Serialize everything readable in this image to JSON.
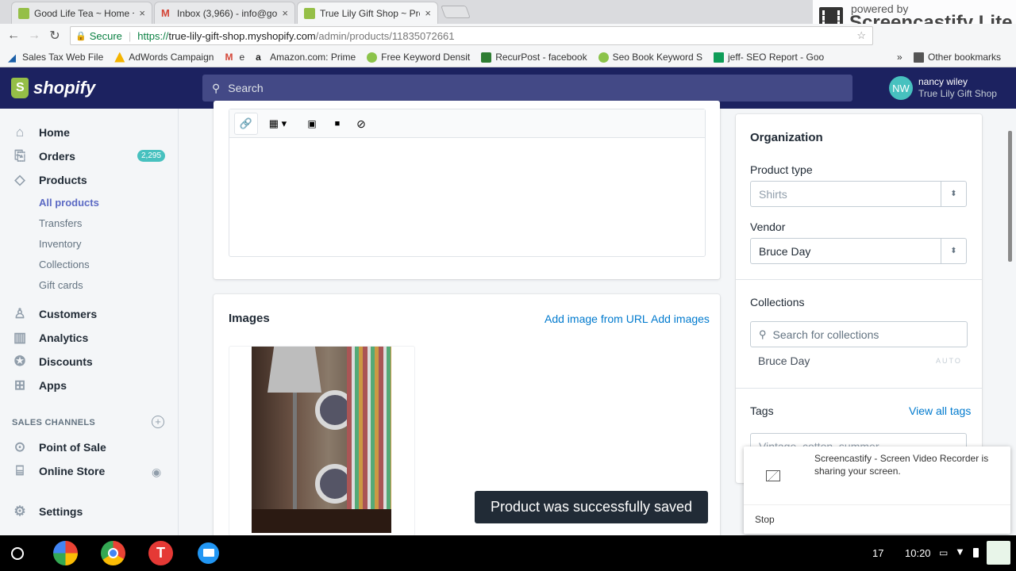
{
  "tabs": [
    {
      "title": "Good Life Tea ~ Home ~",
      "close": "×"
    },
    {
      "title": "Inbox (3,966) - info@goo",
      "close": "×"
    },
    {
      "title": "True Lily Gift Shop ~ Pro",
      "close": "×"
    }
  ],
  "address": {
    "secure_label": "Secure",
    "url_scheme": "https://",
    "url_host": "true-lily-gift-shop.myshopify.com",
    "url_path": "/admin/products/11835072661"
  },
  "bookmarks": [
    {
      "label": "Sales Tax Web File"
    },
    {
      "label": "AdWords Campaign"
    },
    {
      "label": "e"
    },
    {
      "label": "Amazon.com: Prime"
    },
    {
      "label": "Free Keyword Densit"
    },
    {
      "label": "RecurPost - facebook"
    },
    {
      "label": "Seo Book Keyword S"
    },
    {
      "label": "jeff- SEO Report - Goo"
    }
  ],
  "bookmarks_more": "»",
  "other_bookmarks": "Other bookmarks",
  "screencastify_badge": {
    "line1": "powered by",
    "line2": "Screencastify Lite"
  },
  "shopify": {
    "logo_text": "shopify",
    "search_placeholder": "Search",
    "user": {
      "initials": "NW",
      "name": "nancy wiley",
      "store": "True Lily Gift Shop"
    }
  },
  "sidebar": {
    "items": [
      {
        "label": "Home",
        "icon": "home-icon"
      },
      {
        "label": "Orders",
        "icon": "orders-icon",
        "badge": "2,295"
      },
      {
        "label": "Products",
        "icon": "tag-icon"
      }
    ],
    "sub_items": [
      "All products",
      "Transfers",
      "Inventory",
      "Collections",
      "Gift cards"
    ],
    "items2": [
      {
        "label": "Customers",
        "icon": "person-icon"
      },
      {
        "label": "Analytics",
        "icon": "bar-chart-icon"
      },
      {
        "label": "Discounts",
        "icon": "discount-icon"
      },
      {
        "label": "Apps",
        "icon": "apps-icon"
      }
    ],
    "sales_channels_heading": "SALES CHANNELS",
    "channels": [
      {
        "label": "Point of Sale",
        "icon": "location-pin-icon"
      },
      {
        "label": "Online Store",
        "icon": "store-icon"
      }
    ],
    "settings_label": "Settings"
  },
  "images_card": {
    "title": "Images",
    "add_from_url": "Add image from URL",
    "add_images": "Add images"
  },
  "organization": {
    "title": "Organization",
    "product_type_label": "Product type",
    "product_type_placeholder": "Shirts",
    "vendor_label": "Vendor",
    "vendor_value": "Bruce Day",
    "collections_label": "Collections",
    "collections_search_placeholder": "Search for collections",
    "collection_item": "Bruce Day",
    "collection_item_badge": "AUTO",
    "tags_label": "Tags",
    "view_all_tags": "View all tags",
    "tags_value": "Vintage, cotton, summer"
  },
  "toast": "Product was successfully saved",
  "share_notice": {
    "text": "Screencastify - Screen Video Recorder is sharing your screen.",
    "stop": "Stop"
  },
  "taskbar": {
    "notification_count": "17",
    "time": "10:20"
  }
}
